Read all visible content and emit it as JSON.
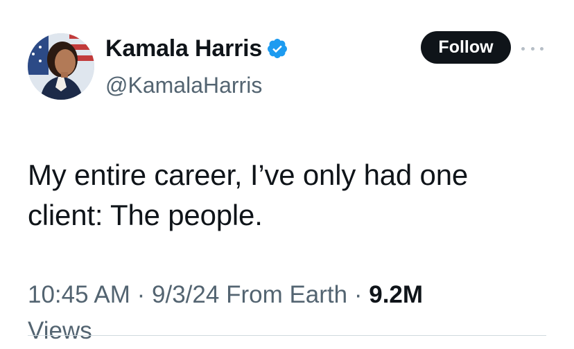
{
  "author": {
    "display_name": "Kamala Harris",
    "handle": "@KamalaHarris",
    "verified": true,
    "verified_color": "#1d9bf0"
  },
  "actions": {
    "follow_label": "Follow",
    "more_icon": "more-horizontal-icon"
  },
  "tweet": {
    "text_lines": [
      "My entire career, I’ve only had one",
      "client: The people."
    ]
  },
  "meta": {
    "time": "10:45 AM",
    "separator": "·",
    "date": "9/3/24",
    "source": "From Earth",
    "views_count": "9.2M",
    "views_label": "Views"
  },
  "colors": {
    "text_primary": "#0f1419",
    "text_secondary": "#536471",
    "button_bg": "#0f1419"
  }
}
